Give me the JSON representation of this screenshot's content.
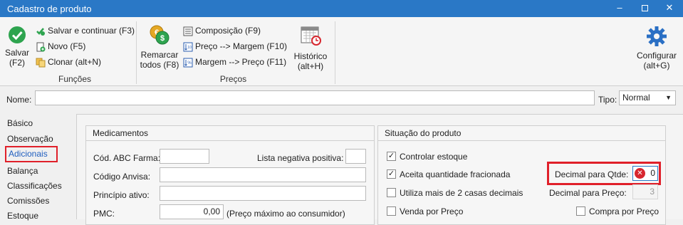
{
  "window": {
    "title": "Cadastro de produto",
    "minimize_icon": "minimize-icon",
    "maximize_icon": "maximize-icon",
    "close_icon": "close-icon"
  },
  "ribbon": {
    "funcoes": {
      "label": "Funções",
      "salvar_line1": "Salvar",
      "salvar_line2": "(F2)",
      "salvar_continuar": "Salvar e continuar (F3)",
      "novo": "Novo (F5)",
      "clonar": "Clonar (alt+N)"
    },
    "precos": {
      "label": "Preços",
      "remarcar_line1": "Remarcar",
      "remarcar_line2": "todos (F8)",
      "composicao": "Composição (F9)",
      "preco_margem": "Preço --> Margem (F10)",
      "margem_preco": "Margem --> Preço (F11)",
      "historico_line1": "Histórico",
      "historico_line2": "(alt+H)"
    },
    "configurar_line1": "Configurar",
    "configurar_line2": "(alt+G)"
  },
  "namebar": {
    "nome_label": "Nome:",
    "nome_value": "",
    "tipo_label": "Tipo:",
    "tipo_value": "Normal"
  },
  "sidebar": {
    "items": [
      {
        "label": "Básico"
      },
      {
        "label": "Observação"
      },
      {
        "label": "Adicionais"
      },
      {
        "label": "Balança"
      },
      {
        "label": "Classificações"
      },
      {
        "label": "Comissões"
      },
      {
        "label": "Estoque"
      }
    ]
  },
  "medicamentos": {
    "title": "Medicamentos",
    "cod_abc_label": "Cód. ABC Farma:",
    "cod_abc_value": "",
    "lista_negativa_label": "Lista negativa positiva:",
    "codigo_anvisa_label": "Código Anvisa:",
    "codigo_anvisa_value": "",
    "principio_ativo_label": "Princípio ativo:",
    "principio_ativo_value": "",
    "pmc_label": "PMC:",
    "pmc_value": "0,00",
    "pmc_hint": "(Preço máximo ao consumidor)"
  },
  "situacao": {
    "title": "Situação do produto",
    "controlar_estoque": "Controlar estoque",
    "aceita_fracionada": "Aceita quantidade fracionada",
    "mais_2_casas": "Utiliza mais de 2 casas decimais",
    "venda_por_preco": "Venda por Preço",
    "decimal_qtde_label": "Decimal para Qtde:",
    "decimal_qtde_value": "0",
    "decimal_preco_label": "Decimal para Preço:",
    "decimal_preco_value": "3",
    "compra_por_preco": "Compra por Preço"
  },
  "colors": {
    "titlebar": "#2a78c6",
    "highlight": "#e0202a",
    "active_link": "#1f5fbf"
  }
}
